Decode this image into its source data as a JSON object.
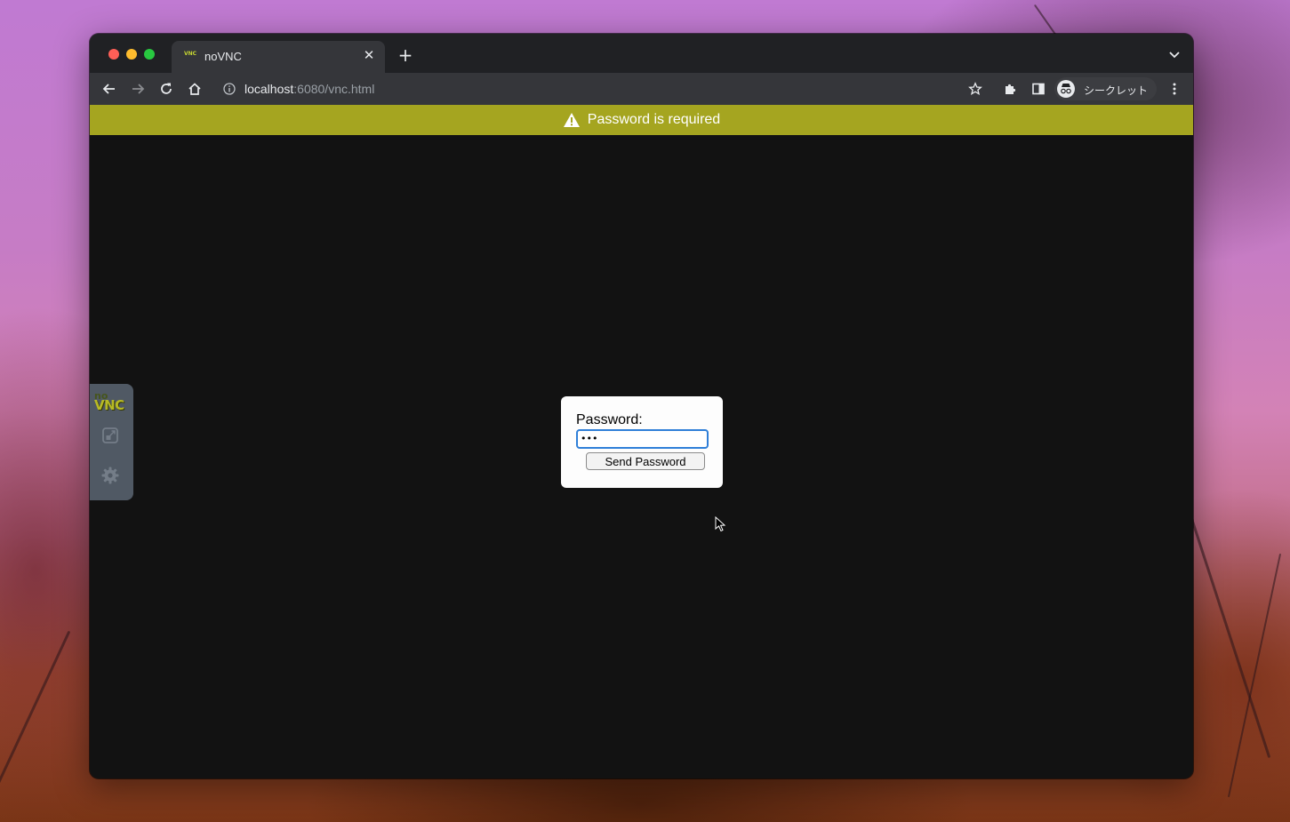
{
  "browser": {
    "tab": {
      "title": "noVNC",
      "favicon_text": "VNC"
    },
    "address_bar": {
      "host": "localhost",
      "path": ":6080/vnc.html"
    },
    "profile": {
      "label": "シークレット"
    },
    "icons": {
      "back": "back-arrow-icon",
      "forward": "forward-arrow-icon",
      "reload": "reload-icon",
      "home": "home-icon",
      "site_info": "info-icon",
      "bookmark": "star-icon",
      "extensions": "puzzle-icon",
      "side_panel": "side-panel-icon",
      "menu": "kebab-menu-icon"
    }
  },
  "novnc": {
    "status": {
      "message": "Password is required",
      "color": "#a5a520"
    },
    "control_bar": {
      "logo_top": "no",
      "logo_bottom": "VNC"
    },
    "credentials_dialog": {
      "password_label": "Password:",
      "password_value": "•••",
      "submit_label": "Send Password"
    }
  }
}
